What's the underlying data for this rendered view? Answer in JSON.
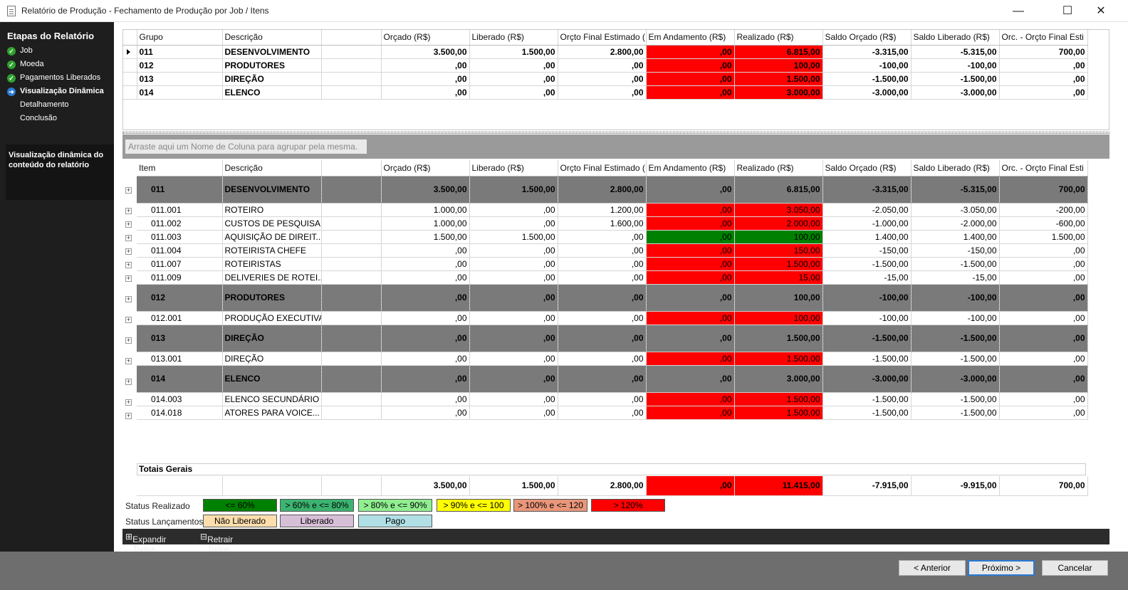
{
  "window": {
    "title": "Relatório de Produção - Fechamento de Produção por Job / Itens"
  },
  "sidebar": {
    "heading": "Etapas do Relatório",
    "steps": [
      {
        "label": "Job",
        "status": "done"
      },
      {
        "label": "Moeda",
        "status": "done"
      },
      {
        "label": "Pagamentos Liberados",
        "status": "done"
      },
      {
        "label": "Visualização Dinâmica",
        "status": "current"
      },
      {
        "label": "Detalhamento",
        "status": "pending"
      },
      {
        "label": "Conclusão",
        "status": "pending"
      }
    ],
    "description": "Visualização dinâmica do conteúdo do relatório"
  },
  "top_grid": {
    "headers": [
      "Grupo",
      "Descrição",
      "",
      "Orçado (R$)",
      "Liberado (R$)",
      "Orçto Final Estimado (",
      "Em Andamento (R$)",
      "Realizado (R$)",
      "Saldo Orçado (R$)",
      "Saldo Liberado (R$)",
      "Orc. - Orçto Final Esti"
    ],
    "rows": [
      {
        "cells": [
          "011",
          "DESENVOLVIMENTO",
          "",
          "3.500,00",
          "1.500,00",
          "2.800,00",
          ",00",
          "6.815,00",
          "-3.315,00",
          "-5.315,00",
          "700,00"
        ]
      },
      {
        "cells": [
          "012",
          "PRODUTORES",
          "",
          ",00",
          ",00",
          ",00",
          ",00",
          "100,00",
          "-100,00",
          "-100,00",
          ",00"
        ]
      },
      {
        "cells": [
          "013",
          "DIREÇÃO",
          "",
          ",00",
          ",00",
          ",00",
          ",00",
          "1.500,00",
          "-1.500,00",
          "-1.500,00",
          ",00"
        ]
      },
      {
        "cells": [
          "014",
          "ELENCO",
          "",
          ",00",
          ",00",
          ",00",
          ",00",
          "3.000,00",
          "-3.000,00",
          "-3.000,00",
          ",00"
        ]
      }
    ]
  },
  "group_panel": {
    "placeholder": "Arraste aqui um Nome de Coluna para agrupar pela mesma."
  },
  "items_grid": {
    "headers": [
      "Item",
      "Descrição",
      "",
      "Orçado (R$)",
      "Liberado (R$)",
      "Orçto Final Estimado (",
      "Em Andamento (R$)",
      "Realizado (R$)",
      "Saldo Orçado (R$)",
      "Saldo Liberado (R$)",
      "Orc. - Orçto Final Esti"
    ],
    "rows": [
      {
        "type": "group",
        "cells": [
          "011",
          "DESENVOLVIMENTO",
          "",
          "3.500,00",
          "1.500,00",
          "2.800,00",
          ",00",
          "6.815,00",
          "-3.315,00",
          "-5.315,00",
          "700,00"
        ]
      },
      {
        "type": "item",
        "status": "red",
        "cells": [
          "011.001",
          "ROTEIRO",
          "",
          "1.000,00",
          ",00",
          "1.200,00",
          ",00",
          "3.050,00",
          "-2.050,00",
          "-3.050,00",
          "-200,00"
        ]
      },
      {
        "type": "item",
        "status": "red",
        "cells": [
          "011.002",
          "CUSTOS DE PESQUISA",
          "",
          "1.000,00",
          ",00",
          "1.600,00",
          ",00",
          "2.000,00",
          "-1.000,00",
          "-2.000,00",
          "-600,00"
        ]
      },
      {
        "type": "item",
        "status": "green",
        "cells": [
          "011.003",
          "AQUISIÇÃO  DE  DIREIT...",
          "",
          "1.500,00",
          "1.500,00",
          ",00",
          ",00",
          "100,00",
          "1.400,00",
          "1.400,00",
          "1.500,00"
        ]
      },
      {
        "type": "item",
        "status": "red",
        "cells": [
          "011.004",
          "ROTEIRISTA CHEFE",
          "",
          ",00",
          ",00",
          ",00",
          ",00",
          "150,00",
          "-150,00",
          "-150,00",
          ",00"
        ]
      },
      {
        "type": "item",
        "status": "red",
        "cells": [
          "011.007",
          "ROTEIRISTAS",
          "",
          ",00",
          ",00",
          ",00",
          ",00",
          "1.500,00",
          "-1.500,00",
          "-1.500,00",
          ",00"
        ]
      },
      {
        "type": "item",
        "status": "red",
        "cells": [
          "011.009",
          "DELIVERIES  DE  ROTEI...",
          "",
          ",00",
          ",00",
          ",00",
          ",00",
          "15,00",
          "-15,00",
          "-15,00",
          ",00"
        ]
      },
      {
        "type": "group",
        "cells": [
          "012",
          "PRODUTORES",
          "",
          ",00",
          ",00",
          ",00",
          ",00",
          "100,00",
          "-100,00",
          "-100,00",
          ",00"
        ]
      },
      {
        "type": "item",
        "status": "red",
        "cells": [
          "012.001",
          "PRODUÇÃO EXECUTIVA",
          "",
          ",00",
          ",00",
          ",00",
          ",00",
          "100,00",
          "-100,00",
          "-100,00",
          ",00"
        ]
      },
      {
        "type": "group",
        "cells": [
          "013",
          "DIREÇÃO",
          "",
          ",00",
          ",00",
          ",00",
          ",00",
          "1.500,00",
          "-1.500,00",
          "-1.500,00",
          ",00"
        ]
      },
      {
        "type": "item",
        "status": "red",
        "cells": [
          "013.001",
          "DIREÇÃO",
          "",
          ",00",
          ",00",
          ",00",
          ",00",
          "1.500,00",
          "-1.500,00",
          "-1.500,00",
          ",00"
        ]
      },
      {
        "type": "group",
        "cells": [
          "014",
          "ELENCO",
          "",
          ",00",
          ",00",
          ",00",
          ",00",
          "3.000,00",
          "-3.000,00",
          "-3.000,00",
          ",00"
        ]
      },
      {
        "type": "item",
        "status": "red",
        "cells": [
          "014.003",
          "ELENCO SECUNDÁRIO",
          "",
          ",00",
          ",00",
          ",00",
          ",00",
          "1.500,00",
          "-1.500,00",
          "-1.500,00",
          ",00"
        ]
      },
      {
        "type": "item",
        "status": "red",
        "cells": [
          "014.018",
          "ATORES  PARA  VOICE...",
          "",
          ",00",
          ",00",
          ",00",
          ",00",
          "1.500,00",
          "-1.500,00",
          "-1.500,00",
          ",00"
        ]
      }
    ],
    "totals_label": "Totais Gerais",
    "totals": [
      "",
      "",
      "",
      "3.500,00",
      "1.500,00",
      "2.800,00",
      ",00",
      "11.415,00",
      "-7.915,00",
      "-9.915,00",
      "700,00"
    ]
  },
  "legend": {
    "realizado_label": "Status Realizado",
    "realizado": [
      {
        "label": "<= 60%",
        "color": "#008000"
      },
      {
        "label": "> 60% e <= 80%",
        "color": "#3cb371"
      },
      {
        "label": "> 80% e <= 90%",
        "color": "#90ee90"
      },
      {
        "label": "> 90% e <= 100",
        "color": "#ffff00"
      },
      {
        "label": "> 100% e <= 120",
        "color": "#e9967a"
      },
      {
        "label": "> 120%",
        "color": "#ff0000"
      }
    ],
    "lancamentos_label": "Status Lançamentos",
    "lancamentos": [
      {
        "label": "Não Liberado",
        "color": "#ffdead"
      },
      {
        "label": "Liberado",
        "color": "#d8bfd8"
      },
      {
        "label": "Pago",
        "color": "#b0e0e6"
      }
    ]
  },
  "toolbar": {
    "expand_label": "Expandir Todos",
    "collapse_label": "Retrair Todos"
  },
  "footer": {
    "back_label": "< Anterior",
    "next_label": "Próximo >",
    "cancel_label": "Cancelar"
  }
}
